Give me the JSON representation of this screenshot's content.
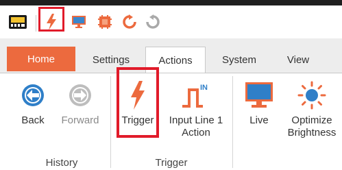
{
  "quick_access": {
    "icons": [
      "camera-app-icon",
      "trigger-icon",
      "monitor-icon",
      "settings-chip-icon",
      "refresh-icon",
      "reload-icon"
    ]
  },
  "tabs": [
    {
      "label": "Home",
      "state": "accent"
    },
    {
      "label": "Settings",
      "state": "normal"
    },
    {
      "label": "Actions",
      "state": "active"
    },
    {
      "label": "System",
      "state": "normal"
    },
    {
      "label": "View",
      "state": "normal"
    }
  ],
  "ribbon": {
    "groups": [
      {
        "label": "History",
        "buttons": [
          {
            "label": "Back",
            "icon": "back-arrow-icon",
            "enabled": true
          },
          {
            "label": "Forward",
            "icon": "forward-arrow-icon",
            "enabled": false
          }
        ]
      },
      {
        "label": "Trigger",
        "buttons": [
          {
            "label": "Trigger",
            "icon": "lightning-bolt-icon",
            "enabled": true
          },
          {
            "label_line1": "Input Line 1",
            "label_line2": "Action",
            "icon": "input-pulse-icon",
            "pulse_text": "IN",
            "enabled": true
          }
        ]
      },
      {
        "label": "",
        "buttons": [
          {
            "label": "Live",
            "icon": "monitor-icon",
            "enabled": true
          },
          {
            "label_line1": "Optimize",
            "label_line2": "Brightness",
            "icon": "sun-icon",
            "enabled": true
          }
        ]
      }
    ]
  },
  "colors": {
    "accent_orange": "#ec6a3e",
    "highlight_red": "#e11b2a",
    "icon_blue": "#2f7fc8"
  }
}
